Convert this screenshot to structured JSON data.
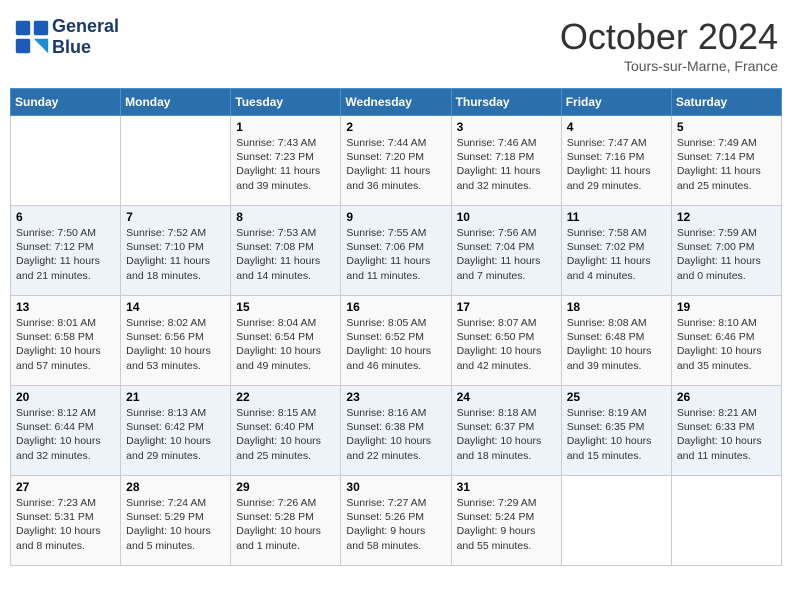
{
  "header": {
    "logo_text_general": "General",
    "logo_text_blue": "Blue",
    "month_title": "October 2024",
    "subtitle": "Tours-sur-Marne, France"
  },
  "weekdays": [
    "Sunday",
    "Monday",
    "Tuesday",
    "Wednesday",
    "Thursday",
    "Friday",
    "Saturday"
  ],
  "weeks": [
    [
      null,
      null,
      {
        "day": "1",
        "sunrise": "7:43 AM",
        "sunset": "7:23 PM",
        "daylight": "11 hours and 39 minutes."
      },
      {
        "day": "2",
        "sunrise": "7:44 AM",
        "sunset": "7:20 PM",
        "daylight": "11 hours and 36 minutes."
      },
      {
        "day": "3",
        "sunrise": "7:46 AM",
        "sunset": "7:18 PM",
        "daylight": "11 hours and 32 minutes."
      },
      {
        "day": "4",
        "sunrise": "7:47 AM",
        "sunset": "7:16 PM",
        "daylight": "11 hours and 29 minutes."
      },
      {
        "day": "5",
        "sunrise": "7:49 AM",
        "sunset": "7:14 PM",
        "daylight": "11 hours and 25 minutes."
      }
    ],
    [
      {
        "day": "6",
        "sunrise": "7:50 AM",
        "sunset": "7:12 PM",
        "daylight": "11 hours and 21 minutes."
      },
      {
        "day": "7",
        "sunrise": "7:52 AM",
        "sunset": "7:10 PM",
        "daylight": "11 hours and 18 minutes."
      },
      {
        "day": "8",
        "sunrise": "7:53 AM",
        "sunset": "7:08 PM",
        "daylight": "11 hours and 14 minutes."
      },
      {
        "day": "9",
        "sunrise": "7:55 AM",
        "sunset": "7:06 PM",
        "daylight": "11 hours and 11 minutes."
      },
      {
        "day": "10",
        "sunrise": "7:56 AM",
        "sunset": "7:04 PM",
        "daylight": "11 hours and 7 minutes."
      },
      {
        "day": "11",
        "sunrise": "7:58 AM",
        "sunset": "7:02 PM",
        "daylight": "11 hours and 4 minutes."
      },
      {
        "day": "12",
        "sunrise": "7:59 AM",
        "sunset": "7:00 PM",
        "daylight": "11 hours and 0 minutes."
      }
    ],
    [
      {
        "day": "13",
        "sunrise": "8:01 AM",
        "sunset": "6:58 PM",
        "daylight": "10 hours and 57 minutes."
      },
      {
        "day": "14",
        "sunrise": "8:02 AM",
        "sunset": "6:56 PM",
        "daylight": "10 hours and 53 minutes."
      },
      {
        "day": "15",
        "sunrise": "8:04 AM",
        "sunset": "6:54 PM",
        "daylight": "10 hours and 49 minutes."
      },
      {
        "day": "16",
        "sunrise": "8:05 AM",
        "sunset": "6:52 PM",
        "daylight": "10 hours and 46 minutes."
      },
      {
        "day": "17",
        "sunrise": "8:07 AM",
        "sunset": "6:50 PM",
        "daylight": "10 hours and 42 minutes."
      },
      {
        "day": "18",
        "sunrise": "8:08 AM",
        "sunset": "6:48 PM",
        "daylight": "10 hours and 39 minutes."
      },
      {
        "day": "19",
        "sunrise": "8:10 AM",
        "sunset": "6:46 PM",
        "daylight": "10 hours and 35 minutes."
      }
    ],
    [
      {
        "day": "20",
        "sunrise": "8:12 AM",
        "sunset": "6:44 PM",
        "daylight": "10 hours and 32 minutes."
      },
      {
        "day": "21",
        "sunrise": "8:13 AM",
        "sunset": "6:42 PM",
        "daylight": "10 hours and 29 minutes."
      },
      {
        "day": "22",
        "sunrise": "8:15 AM",
        "sunset": "6:40 PM",
        "daylight": "10 hours and 25 minutes."
      },
      {
        "day": "23",
        "sunrise": "8:16 AM",
        "sunset": "6:38 PM",
        "daylight": "10 hours and 22 minutes."
      },
      {
        "day": "24",
        "sunrise": "8:18 AM",
        "sunset": "6:37 PM",
        "daylight": "10 hours and 18 minutes."
      },
      {
        "day": "25",
        "sunrise": "8:19 AM",
        "sunset": "6:35 PM",
        "daylight": "10 hours and 15 minutes."
      },
      {
        "day": "26",
        "sunrise": "8:21 AM",
        "sunset": "6:33 PM",
        "daylight": "10 hours and 11 minutes."
      }
    ],
    [
      {
        "day": "27",
        "sunrise": "7:23 AM",
        "sunset": "5:31 PM",
        "daylight": "10 hours and 8 minutes."
      },
      {
        "day": "28",
        "sunrise": "7:24 AM",
        "sunset": "5:29 PM",
        "daylight": "10 hours and 5 minutes."
      },
      {
        "day": "29",
        "sunrise": "7:26 AM",
        "sunset": "5:28 PM",
        "daylight": "10 hours and 1 minute."
      },
      {
        "day": "30",
        "sunrise": "7:27 AM",
        "sunset": "5:26 PM",
        "daylight": "9 hours and 58 minutes."
      },
      {
        "day": "31",
        "sunrise": "7:29 AM",
        "sunset": "5:24 PM",
        "daylight": "9 hours and 55 minutes."
      },
      null,
      null
    ]
  ],
  "labels": {
    "sunrise": "Sunrise:",
    "sunset": "Sunset:",
    "daylight": "Daylight:"
  }
}
